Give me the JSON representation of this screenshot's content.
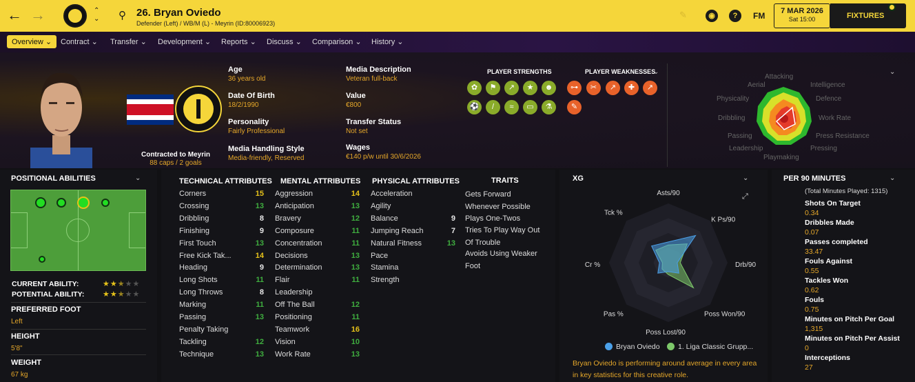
{
  "header": {
    "title": "26. Bryan Oviedo",
    "subtitle": "Defender (Left) / WB/M (L) - Meyrin (ID:80006923)",
    "date": "7 MAR 2026",
    "time": "Sat 15:00",
    "fixtures": "FIXTURES",
    "fm": "FM",
    "help": "?"
  },
  "menu": [
    "Overview",
    "Contract",
    "Transfer",
    "Development",
    "Reports",
    "Discuss",
    "Comparison",
    "History"
  ],
  "info": {
    "age_label": "Age",
    "age": "36 years old",
    "dob_label": "Date Of Birth",
    "dob": "18/2/1990",
    "personality_label": "Personality",
    "personality": "Fairly Professional",
    "media_style_label": "Media Handling Style",
    "media_style": "Media-friendly, Reserved",
    "media_desc_label": "Media Description",
    "media_desc": "Veteran full-back",
    "value_label": "Value",
    "value": "€800",
    "transfer_label": "Transfer Status",
    "transfer": "Not set",
    "wages_label": "Wages",
    "wages": "€140 p/w until 30/6/2026",
    "contracted": "Contracted to Meyrin",
    "caps": "88 caps / 2 goals"
  },
  "strengths_title": "PLAYER STRENGTHS",
  "weaknesses_title": "PLAYER WEAKNESSES",
  "attr_radar_labels": [
    "Attacking",
    "Aerial",
    "Intelligence",
    "Physicality",
    "Defence",
    "Dribbling",
    "Work Rate",
    "Passing",
    "Press Resistance",
    "Leadership",
    "Pressing",
    "Playmaking"
  ],
  "positional": {
    "title": "POSITIONAL ABILITIES",
    "current_label": "CURRENT ABILITY:",
    "potential_label": "POTENTIAL ABILITY:",
    "current_stars": 2.5,
    "potential_stars": 2.5,
    "foot_label": "PREFERRED FOOT",
    "foot": "Left",
    "height_label": "HEIGHT",
    "height": "5'8\"",
    "weight_label": "WEIGHT",
    "weight": "67 kg"
  },
  "technical": {
    "title": "TECHNICAL ATTRIBUTES",
    "rows": [
      [
        "Corners",
        "15"
      ],
      [
        "Crossing",
        "13"
      ],
      [
        "Dribbling",
        "8"
      ],
      [
        "Finishing",
        "9"
      ],
      [
        "First Touch",
        "13"
      ],
      [
        "Free Kick Tak...",
        "14"
      ],
      [
        "Heading",
        "9"
      ],
      [
        "Long Shots",
        "11"
      ],
      [
        "Long Throws",
        "8"
      ],
      [
        "Marking",
        "11"
      ],
      [
        "Passing",
        "13"
      ],
      [
        "Penalty Taking",
        ""
      ],
      [
        "Tackling",
        "12"
      ],
      [
        "Technique",
        "13"
      ]
    ]
  },
  "mental": {
    "title": "MENTAL ATTRIBUTES",
    "rows": [
      [
        "Aggression",
        "14"
      ],
      [
        "Anticipation",
        "13"
      ],
      [
        "Bravery",
        "12"
      ],
      [
        "Composure",
        "11"
      ],
      [
        "Concentration",
        "11"
      ],
      [
        "Decisions",
        "13"
      ],
      [
        "Determination",
        "13"
      ],
      [
        "Flair",
        "11"
      ],
      [
        "Leadership",
        ""
      ],
      [
        "Off The Ball",
        "12"
      ],
      [
        "Positioning",
        "11"
      ],
      [
        "Teamwork",
        "16"
      ],
      [
        "Vision",
        "10"
      ],
      [
        "Work Rate",
        "13"
      ]
    ]
  },
  "physical": {
    "title": "PHYSICAL ATTRIBUTES",
    "rows": [
      [
        "Acceleration",
        ""
      ],
      [
        "Agility",
        ""
      ],
      [
        "Balance",
        "9"
      ],
      [
        "Jumping Reach",
        "7"
      ],
      [
        "Natural Fitness",
        "13"
      ],
      [
        "Pace",
        ""
      ],
      [
        "Stamina",
        ""
      ],
      [
        "Strength",
        ""
      ]
    ]
  },
  "traits": {
    "title": "TRAITS",
    "items": [
      "Gets Forward Whenever Possible",
      "Plays One-Twos",
      "Tries To Play Way Out Of Trouble",
      "Avoids Using Weaker Foot"
    ]
  },
  "xg": {
    "title": "XG",
    "labels": [
      "Asts/90",
      "K Ps/90",
      "Drb/90",
      "Poss Won/90",
      "Poss Lost/90",
      "Pas %",
      "Cr %",
      "Tck %"
    ],
    "legend_player": "Bryan Oviedo",
    "legend_league": "1. Liga Classic Grupp...",
    "summary": "Bryan Oviedo is performing around average in every area in key statistics for this creative role."
  },
  "chart_data": {
    "type": "radar",
    "axes": [
      "Asts/90",
      "K Ps/90",
      "Drb/90",
      "Poss Won/90",
      "Poss Lost/90",
      "Pas %",
      "Cr %",
      "Tck %"
    ],
    "series": [
      {
        "name": "Bryan Oviedo",
        "values": [
          0.35,
          0.65,
          0.15,
          0.25,
          0.15,
          0.25,
          0.15,
          0.4
        ]
      },
      {
        "name": "1. Liga Classic Grupp...",
        "values": [
          0.3,
          0.45,
          0.2,
          0.6,
          0.2,
          0.15,
          0.1,
          0.3
        ]
      }
    ]
  },
  "per90": {
    "title": "PER 90 MINUTES",
    "total": "(Total Minutes Played: 1315)",
    "rows": [
      [
        "Shots On Target",
        "0.34"
      ],
      [
        "Dribbles Made",
        "0.07"
      ],
      [
        "Passes completed",
        "33.47"
      ],
      [
        "Fouls Against",
        "0.55"
      ],
      [
        "Tackles Won",
        "0.62"
      ],
      [
        "Fouls",
        "0.75"
      ],
      [
        "Minutes on Pitch Per Goal",
        "1,315"
      ],
      [
        "Minutes on Pitch Per Assist",
        "0"
      ],
      [
        "Interceptions",
        "27"
      ]
    ]
  },
  "colors": {
    "accent": "#f5d63a",
    "good": "#3fae3f",
    "great": "#e6c21a",
    "value": "#e6a82a"
  }
}
